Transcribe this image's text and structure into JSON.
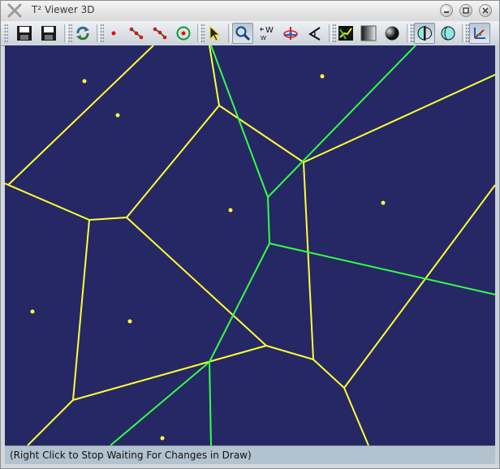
{
  "window": {
    "title": "T² Viewer 3D",
    "controls": [
      "minimize-icon",
      "maximize-icon",
      "close-icon"
    ]
  },
  "toolbar": {
    "groups": [
      [
        "save-icon",
        "save-as-icon"
      ],
      [
        "refresh-icon"
      ],
      [
        "points-mode-icon",
        "segments-mode-icon",
        "polyline-mode-icon",
        "circle-mode-icon"
      ],
      [
        "select-arrow-icon"
      ],
      [
        "zoom-icon",
        "world-axes-icon",
        "rotate-axes-icon",
        "angle-icon"
      ],
      [
        "edge-mode-icon",
        "gradient-icon",
        "shading-icon"
      ],
      [
        "clip-icon",
        "sphere-icon"
      ],
      [
        "axes-icon"
      ]
    ]
  },
  "colors": {
    "canvas_background": "#252865",
    "voronoi_edges": "#ffff33",
    "secondary_edges": "#33ff44",
    "sites": "#ffff33"
  },
  "status": {
    "message": "(Right Click to Stop Waiting For Changes in Draw)"
  }
}
